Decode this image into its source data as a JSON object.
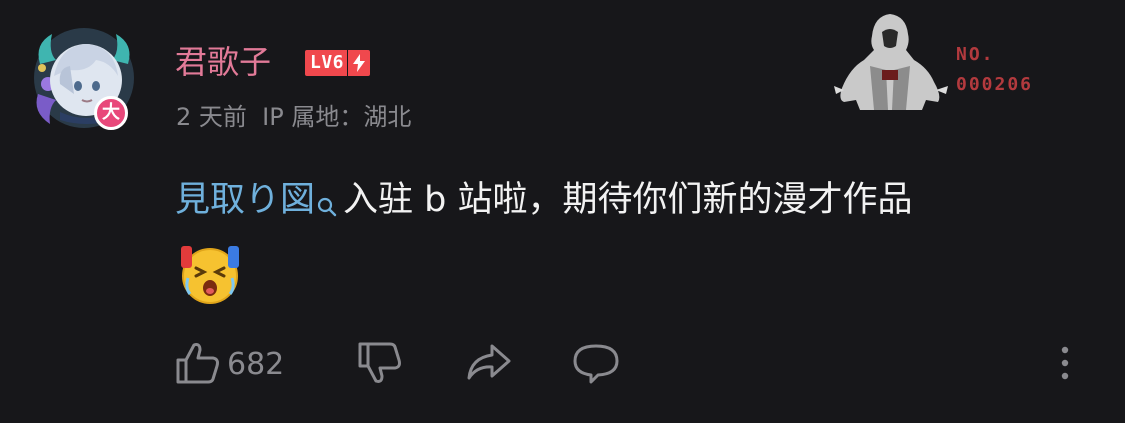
{
  "user": {
    "name": "君歌子",
    "level_label": "LV6",
    "avatar_badge": "大",
    "time": "2 天前",
    "ip_location": "IP 属地：湖北"
  },
  "fan_card": {
    "number_label": "NO.",
    "number_value": "000206"
  },
  "comment": {
    "link_text": "見取り図",
    "body_text": "入驻 b 站啦，期待你们新的漫才作品",
    "emoji": "crying-face-emoji"
  },
  "actions": {
    "like_count": "682"
  },
  "icons": {
    "like": "thumbs-up-icon",
    "dislike": "thumbs-down-icon",
    "share": "share-icon",
    "reply": "comment-icon",
    "more": "more-vertical-icon",
    "search_mark": "search-icon",
    "bolt": "lightning-icon"
  },
  "colors": {
    "background": "#17171a",
    "username": "#e27a98",
    "level_badge": "#f0484d",
    "link": "#6fb0dc",
    "meta": "#8a8a8f",
    "fan_number": "#b33a3e"
  }
}
